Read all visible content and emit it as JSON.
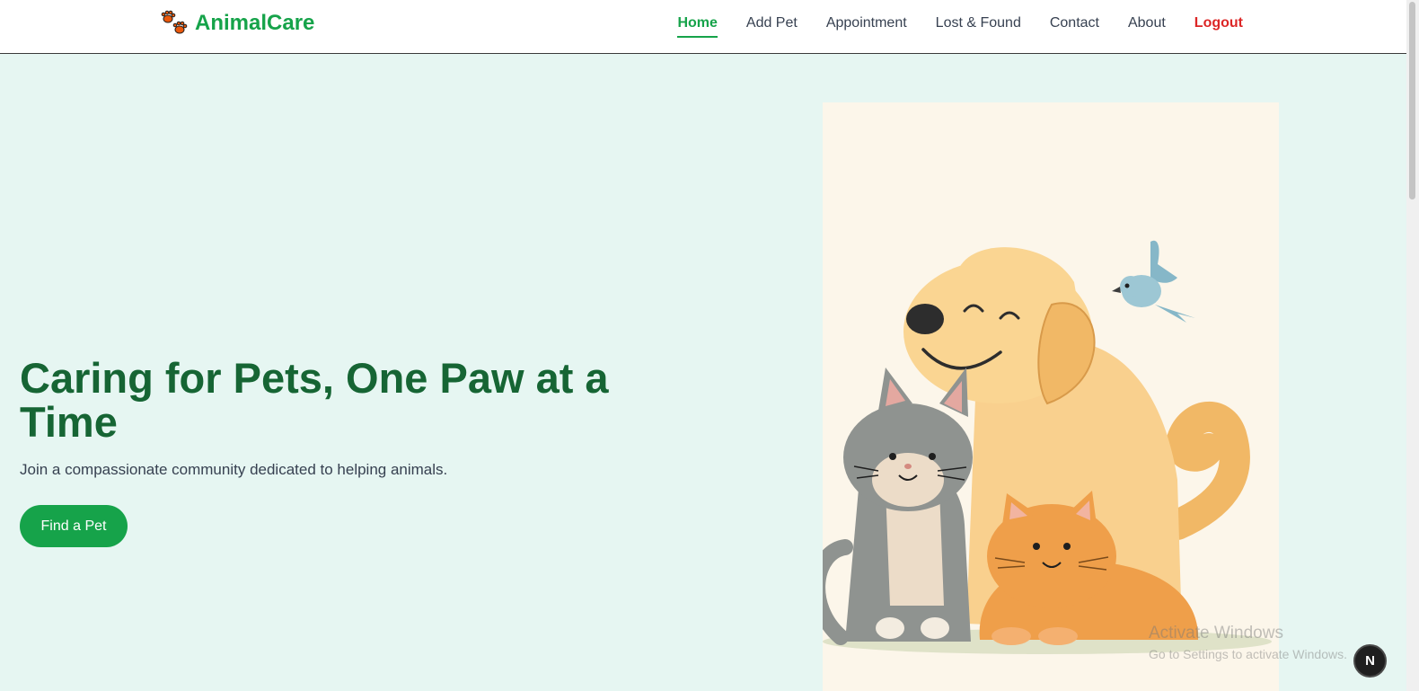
{
  "brand": {
    "name": "AnimalCare",
    "logo_icon": "paw-prints-icon"
  },
  "nav": {
    "items": [
      {
        "label": "Home",
        "active": true
      },
      {
        "label": "Add Pet"
      },
      {
        "label": "Appointment"
      },
      {
        "label": "Lost & Found"
      },
      {
        "label": "Contact"
      },
      {
        "label": "About"
      }
    ],
    "logout_label": "Logout"
  },
  "hero": {
    "title": "Caring for Pets, One Paw at a Time",
    "subtitle": "Join a compassionate community dedicated to helping animals.",
    "cta_label": "Find a Pet",
    "illustration": "dog-cats-bird-illustration"
  },
  "watermark": {
    "title": "Activate Windows",
    "subtitle": "Go to Settings to activate Windows."
  },
  "badge": {
    "label": "N"
  },
  "colors": {
    "brand_green": "#16a34a",
    "title_green": "#166534",
    "logout_red": "#dc2626",
    "page_bg": "#e6f6f2"
  }
}
